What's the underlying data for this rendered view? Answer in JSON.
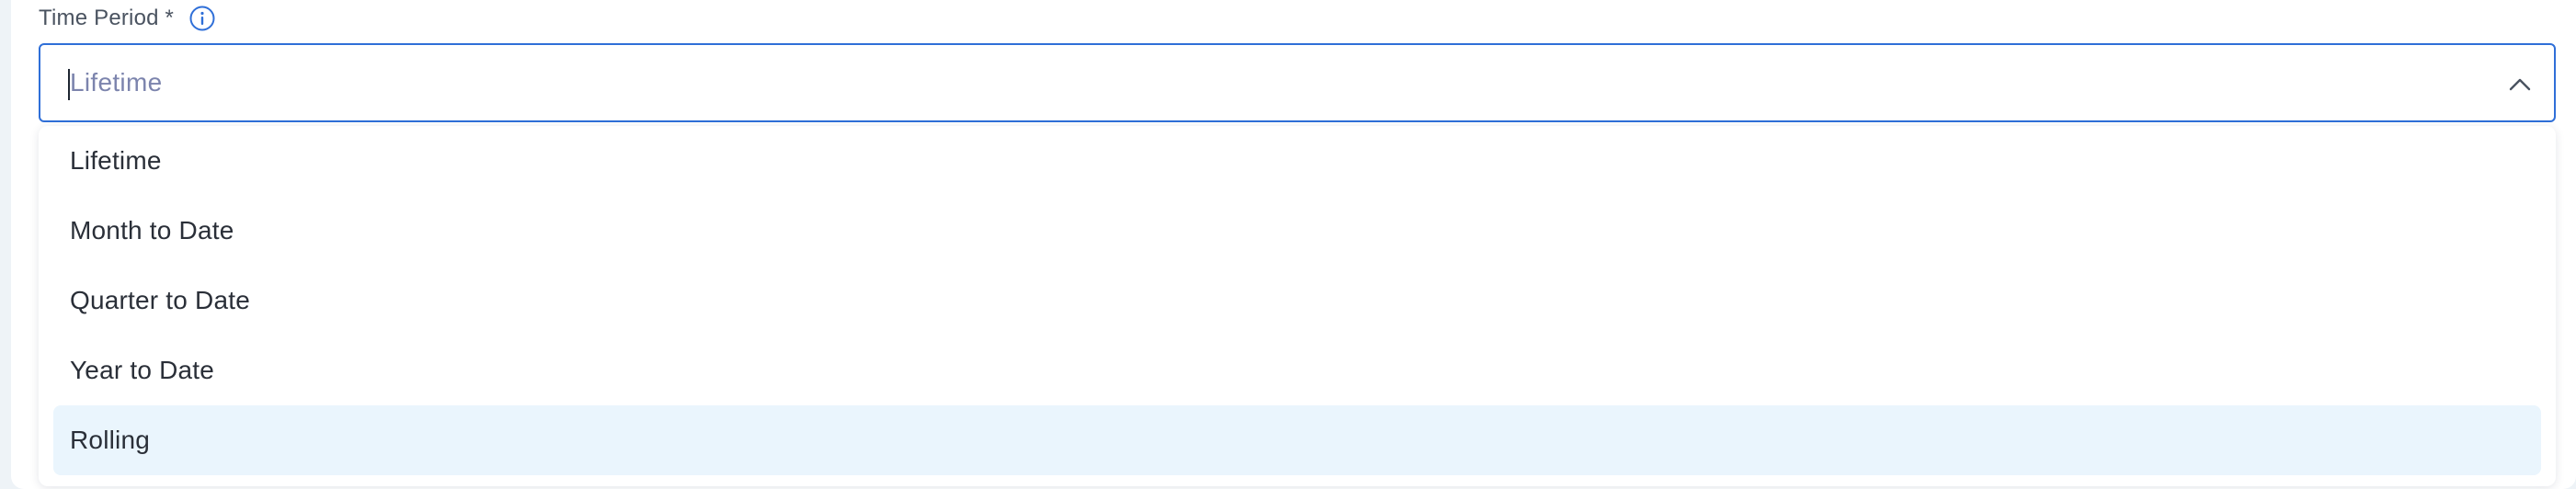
{
  "field": {
    "label": "Time Period *",
    "info_icon": "info-circle-icon",
    "value": "Lifetime",
    "chevron_icon": "chevron-up-icon",
    "border_color": "#2f6fd8"
  },
  "menu": {
    "highlight_color": "#eaf5fd",
    "options": [
      {
        "label": "Lifetime"
      },
      {
        "label": "Month to Date"
      },
      {
        "label": "Quarter to Date"
      },
      {
        "label": "Year to Date"
      },
      {
        "label": "Rolling",
        "highlighted": true
      }
    ]
  }
}
